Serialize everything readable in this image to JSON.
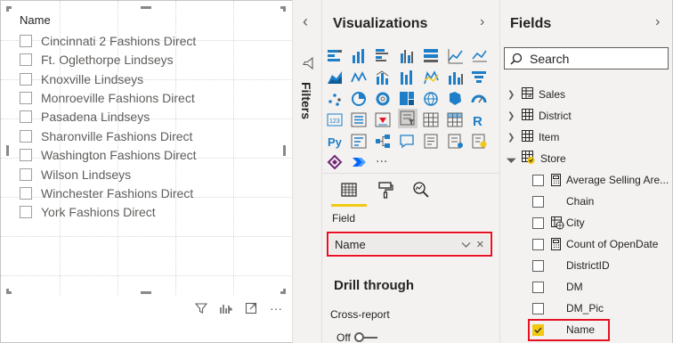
{
  "slicer": {
    "title": "Name",
    "items": [
      "Cincinnati 2 Fashions Direct",
      "Ft. Oglethorpe Lindseys",
      "Knoxville Lindseys",
      "Monroeville Fashions Direct",
      "Pasadena Lindseys",
      "Sharonville Fashions Direct",
      "Washington Fashions Direct",
      "Wilson Lindseys",
      "Winchester Fashions Direct",
      "York Fashions Direct"
    ],
    "toolbar_more": "···"
  },
  "filters": {
    "collapse_chevron": "‹",
    "label": "Filters"
  },
  "visualizations": {
    "title": "Visualizations",
    "chevron": "›",
    "more_visuals": "···",
    "field_label": "Field",
    "field_value": "Name",
    "field_dropdown": "⌵",
    "field_remove": "✕",
    "drill_through_title": "Drill through",
    "cross_report_label": "Cross-report",
    "toggle_state": "Off"
  },
  "fields": {
    "title": "Fields",
    "chevron": "›",
    "search_placeholder": "Search",
    "tables": [
      {
        "name": "Sales",
        "expanded": false
      },
      {
        "name": "District",
        "expanded": false
      },
      {
        "name": "Item",
        "expanded": false
      },
      {
        "name": "Store",
        "expanded": true
      }
    ],
    "store_fields": [
      {
        "label": "Average Selling Are...",
        "icon": "calculator-icon",
        "checked": false
      },
      {
        "label": "Chain",
        "icon": "",
        "checked": false
      },
      {
        "label": "City",
        "icon": "globe-table-icon",
        "checked": false
      },
      {
        "label": "Count of OpenDate",
        "icon": "calculator-icon",
        "checked": false
      },
      {
        "label": "DistrictID",
        "icon": "",
        "checked": false
      },
      {
        "label": "DM",
        "icon": "",
        "checked": false
      },
      {
        "label": "DM_Pic",
        "icon": "",
        "checked": false
      },
      {
        "label": "Name",
        "icon": "",
        "checked": true
      }
    ]
  },
  "colors": {
    "accent_yellow": "#f2c811",
    "highlight_red": "#e81123",
    "pane_bg": "#f3f2f1"
  }
}
